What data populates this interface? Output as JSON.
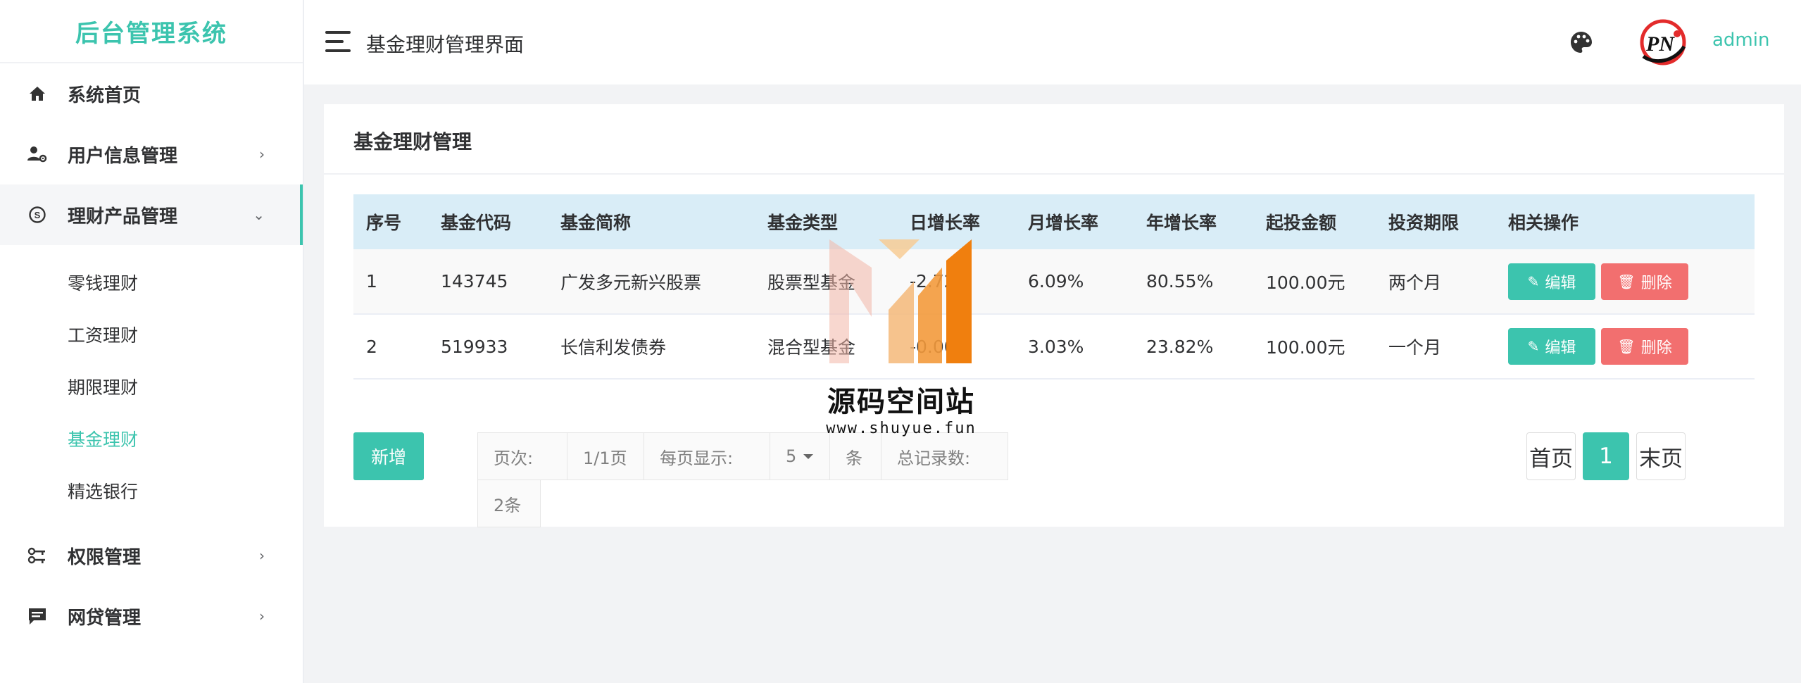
{
  "sidebar": {
    "brand": "后台管理系统",
    "items": [
      {
        "label": "系统首页",
        "icon": "home-icon"
      },
      {
        "label": "用户信息管理",
        "icon": "user-settings-icon"
      },
      {
        "label": "理财产品管理",
        "icon": "finance-icon",
        "open": true,
        "children": [
          "零钱理财",
          "工资理财",
          "期限理财",
          "基金理财",
          "精选银行"
        ],
        "active_child": "基金理财"
      },
      {
        "label": "权限管理",
        "icon": "key-icon"
      },
      {
        "label": "网贷管理",
        "icon": "message-icon"
      }
    ]
  },
  "header": {
    "title": "基金理财管理界面",
    "username": "admin",
    "avatar_text": "PN"
  },
  "main": {
    "title": "基金理财管理",
    "columns": [
      "序号",
      "基金代码",
      "基金简称",
      "基金类型",
      "日增长率",
      "月增长率",
      "年增长率",
      "起投金额",
      "投资期限",
      "相关操作"
    ],
    "rows": [
      {
        "no": "1",
        "code": "143745",
        "name": "广发多元新兴股票",
        "type": "股票型基金",
        "day": "-2.72",
        "month": "6.09%",
        "year": "80.55%",
        "min": "100.00元",
        "term": "两个月"
      },
      {
        "no": "2",
        "code": "519933",
        "name": "长信利发债券",
        "type": "混合型基金",
        "day": "-0.00",
        "month": "3.03%",
        "year": "23.82%",
        "min": "100.00元",
        "term": "一个月"
      }
    ],
    "edit_label": "编辑",
    "delete_label": "删除",
    "add_label": "新增"
  },
  "pagination_info": {
    "page_label": "页次:",
    "page_value": "1/1页",
    "per_page_label": "每页显示:",
    "per_page_value": "5",
    "unit": "条",
    "total_label": "总记录数:",
    "total_value": "2条"
  },
  "pager": {
    "first": "首页",
    "current": "1",
    "last": "末页"
  },
  "watermark": {
    "text": "源码空间站",
    "url": "www.shuyue.fun"
  },
  "colors": {
    "accent": "#3cc4ae",
    "danger": "#f26f6f",
    "table_header": "#d9edf7"
  }
}
